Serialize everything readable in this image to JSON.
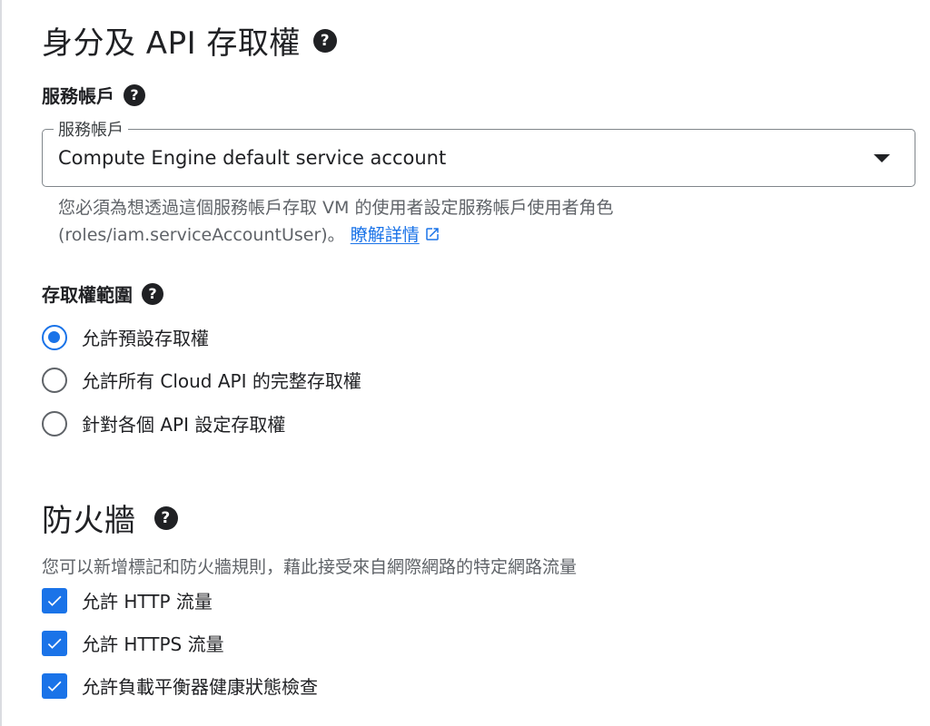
{
  "identity_section": {
    "title": "身分及 API 存取權",
    "help_icon": "help-icon"
  },
  "service_account": {
    "heading": "服務帳戶",
    "help_icon": "help-icon",
    "field_label": "服務帳戶",
    "selected_value": "Compute Engine default service account",
    "dropdown_icon": "dropdown-arrow-icon",
    "helper_line1": "您必須為想透過這個服務帳戶存取 VM 的使用者設定服務帳戶使用者角色",
    "helper_line2": "(roles/iam.serviceAccountUser)。",
    "learn_more_link": "瞭解詳情",
    "external_link_icon": "open-in-new-icon"
  },
  "access_scopes": {
    "heading": "存取權範圍",
    "help_icon": "help-icon",
    "options": [
      {
        "label": "允許預設存取權",
        "selected": true
      },
      {
        "label": "允許所有 Cloud API 的完整存取權",
        "selected": false
      },
      {
        "label": "針對各個 API 設定存取權",
        "selected": false
      }
    ]
  },
  "firewall_section": {
    "title": "防火牆",
    "help_icon": "help-icon",
    "description": "您可以新增標記和防火牆規則，藉此接受來自網際網路的特定網路流量",
    "options": [
      {
        "label": "允許 HTTP 流量",
        "checked": true
      },
      {
        "label": "允許 HTTPS 流量",
        "checked": true
      },
      {
        "label": "允許負載平衡器健康狀態檢查",
        "checked": true
      }
    ]
  },
  "colors": {
    "accent": "#1a73e8",
    "text_primary": "#202124",
    "text_secondary": "#5f6368",
    "outline": "#80868b"
  }
}
